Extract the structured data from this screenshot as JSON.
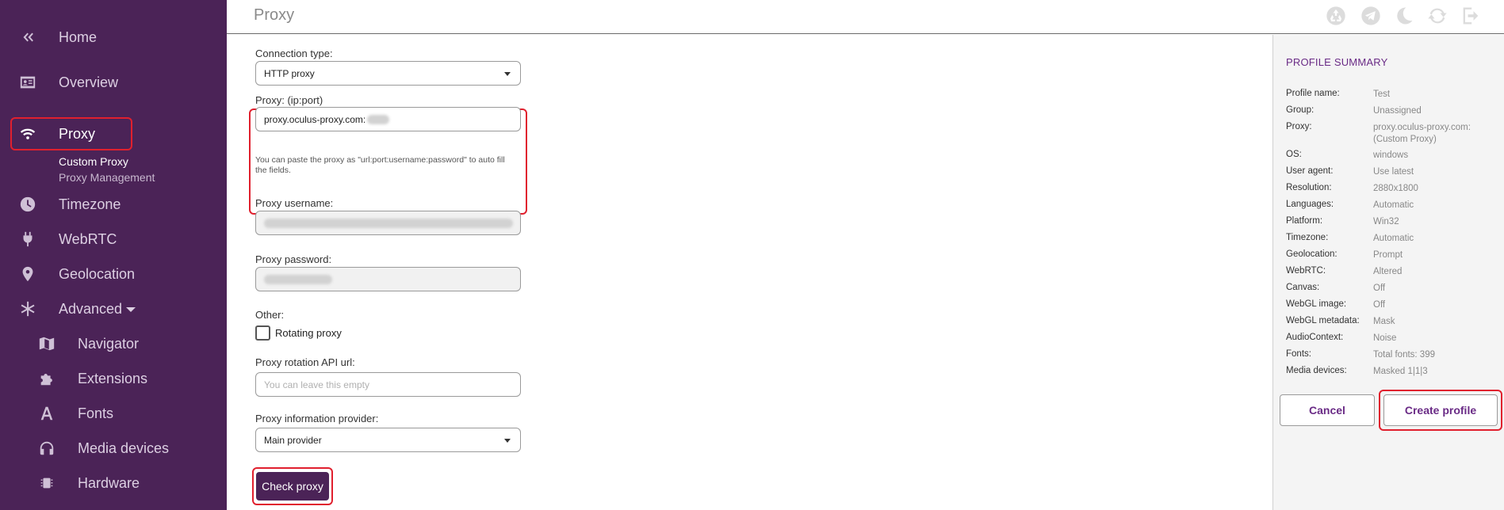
{
  "sidebar": {
    "home_label": "Home",
    "overview_label": "Overview",
    "proxy_label": "Proxy",
    "proxy_sub": [
      "Custom Proxy",
      "Proxy Management"
    ],
    "timezone_label": "Timezone",
    "webrtc_label": "WebRTC",
    "geolocation_label": "Geolocation",
    "advanced_label": "Advanced",
    "advanced_items": [
      "Navigator",
      "Extensions",
      "Fonts",
      "Media devices",
      "Hardware"
    ]
  },
  "header": {
    "title": "Proxy",
    "icons": [
      "recycle-icon",
      "telegram-icon",
      "moon-icon",
      "refresh-icon",
      "logout-icon"
    ]
  },
  "form": {
    "connection_type_label": "Connection type:",
    "connection_type_value": "HTTP proxy",
    "proxy_label": "Proxy: (ip:port)",
    "proxy_value": "proxy.oculus-proxy.com:",
    "proxy_hint": "You can paste the proxy as \"url:port:username:password\" to auto fill the fields.",
    "username_label": "Proxy username:",
    "password_label": "Proxy password:",
    "other_label": "Other:",
    "rotating_label": "Rotating proxy",
    "rotation_api_label": "Proxy rotation API url:",
    "rotation_api_placeholder": "You can leave this empty",
    "info_provider_label": "Proxy information provider:",
    "info_provider_value": "Main provider",
    "check_button": "Check proxy"
  },
  "summary": {
    "title": "PROFILE SUMMARY",
    "rows": [
      {
        "key": "Profile name:",
        "value": "Test"
      },
      {
        "key": "Group:",
        "value": "Unassigned"
      },
      {
        "key": "Proxy:",
        "value": "proxy.oculus-proxy.com: (Custom Proxy)"
      },
      {
        "key": "OS:",
        "value": "windows"
      },
      {
        "key": "User agent:",
        "value": "Use latest"
      },
      {
        "key": "Resolution:",
        "value": "2880x1800"
      },
      {
        "key": "Languages:",
        "value": "Automatic"
      },
      {
        "key": "Platform:",
        "value": "Win32"
      },
      {
        "key": "Timezone:",
        "value": "Automatic"
      },
      {
        "key": "Geolocation:",
        "value": "Prompt"
      },
      {
        "key": "WebRTC:",
        "value": "Altered"
      },
      {
        "key": "Canvas:",
        "value": "Off"
      },
      {
        "key": "WebGL image:",
        "value": "Off"
      },
      {
        "key": "WebGL metadata:",
        "value": "Mask"
      },
      {
        "key": "AudioContext:",
        "value": "Noise"
      },
      {
        "key": "Fonts:",
        "value": "Total fonts: 399"
      },
      {
        "key": "Media devices:",
        "value": "Masked 1|1|3"
      }
    ],
    "cancel_button": "Cancel",
    "create_button": "Create profile"
  },
  "colors": {
    "sidebar_bg": "#4b2357",
    "accent": "#6a2b86",
    "highlight": "#e0202e"
  }
}
